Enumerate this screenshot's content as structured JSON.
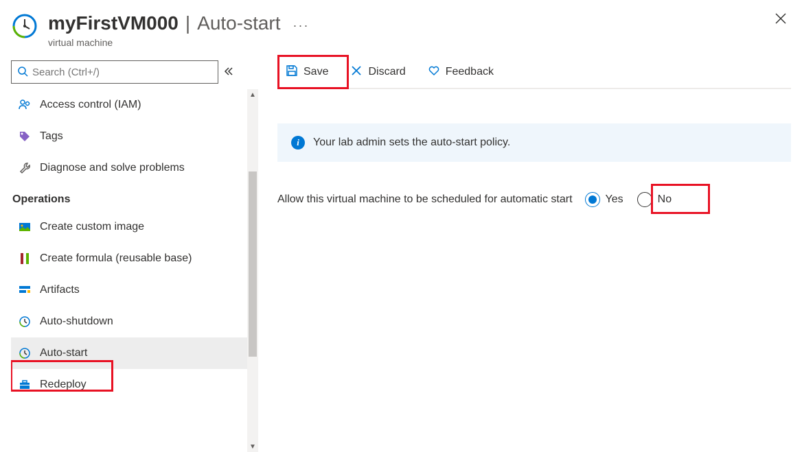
{
  "header": {
    "vm_name": "myFirstVM000",
    "page_title": "Auto-start",
    "subtitle": "virtual machine"
  },
  "search": {
    "placeholder": "Search (Ctrl+/)"
  },
  "sidebar": {
    "items": [
      {
        "label": "Access control (IAM)",
        "icon": "people-icon"
      },
      {
        "label": "Tags",
        "icon": "tag-icon"
      },
      {
        "label": "Diagnose and solve problems",
        "icon": "wrench-icon"
      }
    ],
    "operations_header": "Operations",
    "operations": [
      {
        "label": "Create custom image",
        "icon": "image-icon"
      },
      {
        "label": "Create formula (reusable base)",
        "icon": "formula-icon"
      },
      {
        "label": "Artifacts",
        "icon": "artifacts-icon"
      },
      {
        "label": "Auto-shutdown",
        "icon": "clock-icon"
      },
      {
        "label": "Auto-start",
        "icon": "clock-green-icon",
        "active": true
      },
      {
        "label": "Redeploy",
        "icon": "briefcase-icon"
      }
    ]
  },
  "toolbar": {
    "save_label": "Save",
    "discard_label": "Discard",
    "feedback_label": "Feedback"
  },
  "content": {
    "info_text": "Your lab admin sets the auto-start policy.",
    "setting_label": "Allow this virtual machine to be scheduled for automatic start",
    "yes_label": "Yes",
    "no_label": "No",
    "selected_value": "yes"
  }
}
